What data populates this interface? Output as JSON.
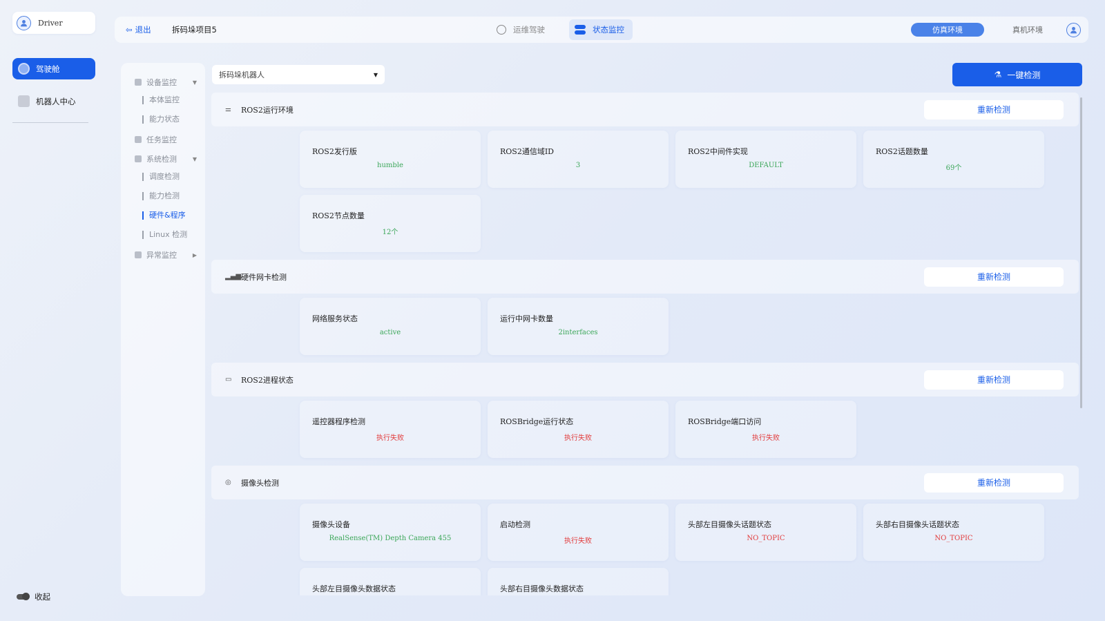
{
  "rail": {
    "user_name": "Driver",
    "items": [
      {
        "label": "驾驶舱",
        "active": true
      },
      {
        "label": "机器人中心",
        "active": false
      }
    ],
    "collapse_label": "收起"
  },
  "topbar": {
    "exit_label": "退出",
    "project_name": "拆码垛项目5",
    "nav_ops_label": "运维驾驶",
    "nav_status_label": "状态监控",
    "env_sim_label": "仿真环境",
    "env_real_label": "真机环境"
  },
  "submenu": {
    "groups": [
      {
        "label": "设备监控",
        "children": [
          "本体监控",
          "能力状态"
        ]
      },
      {
        "label": "任务监控"
      },
      {
        "label": "系统检测",
        "children": [
          "调度检测",
          "能力检测",
          "硬件&程序",
          "Linux 检测"
        ]
      },
      {
        "label": "异常监控"
      }
    ],
    "active_item": "硬件&程序"
  },
  "robot_select": {
    "value": "拆码垛机器人"
  },
  "one_key_label": "一键检测",
  "recheck_label": "重新检测",
  "sections": [
    {
      "title": "ROS2运行环境",
      "cards": [
        {
          "label": "ROS2发行版",
          "value": "humble",
          "status": "ok"
        },
        {
          "label": "ROS2通信域ID",
          "value": "3",
          "status": "ok"
        },
        {
          "label": "ROS2中间件实现",
          "value": "DEFAULT",
          "status": "ok"
        },
        {
          "label": "ROS2话题数量",
          "value": "69个",
          "status": "ok"
        },
        {
          "label": "ROS2节点数量",
          "value": "12个",
          "status": "ok"
        }
      ]
    },
    {
      "title": "硬件网卡检测",
      "cards": [
        {
          "label": "网络服务状态",
          "value": "active",
          "status": "ok"
        },
        {
          "label": "运行中网卡数量",
          "value": "2interfaces",
          "status": "ok"
        }
      ]
    },
    {
      "title": "ROS2进程状态",
      "cards": [
        {
          "label": "遥控器程序检测",
          "value": "执行失败",
          "status": "bad"
        },
        {
          "label": "ROSBridge运行状态",
          "value": "执行失败",
          "status": "bad"
        },
        {
          "label": "ROSBridge端口访问",
          "value": "执行失败",
          "status": "bad"
        }
      ]
    },
    {
      "title": "摄像头检测",
      "cards": [
        {
          "label": "摄像头设备",
          "value": "RealSense(TM) Depth Camera 455",
          "status": "ok"
        },
        {
          "label": "启动检测",
          "value": "执行失败",
          "status": "bad"
        },
        {
          "label": "头部左目摄像头话题状态",
          "value": "NO_TOPIC",
          "status": "bad"
        },
        {
          "label": "头部右目摄像头话题状态",
          "value": "NO_TOPIC",
          "status": "bad"
        },
        {
          "label": "头部左目摄像头数据状态",
          "value": "",
          "status": "ok"
        },
        {
          "label": "头部右目摄像头数据状态",
          "value": "",
          "status": "ok"
        }
      ]
    }
  ]
}
